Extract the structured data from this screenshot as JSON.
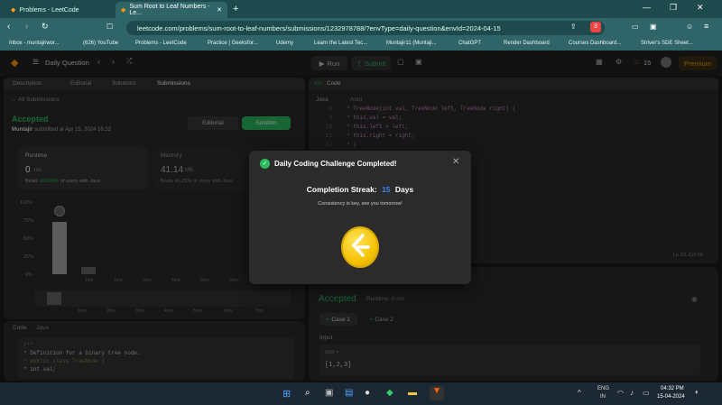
{
  "browser": {
    "tabs": [
      {
        "label": "Problems - LeetCode"
      },
      {
        "label": "Sum Root to Leaf Numbers - Le..."
      }
    ],
    "new_tab": "+",
    "url": "leetcode.com/problems/sum-root-to-leaf-numbers/submissions/1232978788/?envType=daily-question&envId=2024-04-15",
    "bookmarks": [
      "Inbox - muntajirwor...",
      "(626) YouTube",
      "Problems - LeetCode",
      "Practice | Geeksfor...",
      "Udemy",
      "Learn the Latest Tec...",
      "Muntajir11 (Muntaji...",
      "ChatGPT",
      "Render Dashboard",
      "Courses Dashboard...",
      "Striver's SDE Sheet..."
    ],
    "shield_count": "3"
  },
  "lc": {
    "daily_question": "Daily Question",
    "run": "Run",
    "submit": "Submit",
    "streak": "15",
    "premium": "Premium",
    "left_tabs": [
      "Description",
      "Editorial",
      "Solutions",
      "Submissions"
    ],
    "all_submissions": "All Submissions",
    "status": "Accepted",
    "user": "Muntajir",
    "submitted_text": "submitted at Apr 15, 2024 16:32",
    "editorial_btn": "Editorial",
    "solution_btn": "Solution",
    "runtime_label": "Runtime",
    "runtime_value": "0",
    "runtime_unit": "ms",
    "beats_prefix": "Beats",
    "beats_runtime": "100.00%",
    "beats_suffix": "of users with Java",
    "memory_label": "Memory",
    "memory_value": "41.14",
    "memory_unit": "MB",
    "beats_memory": "Beats 41.25% of users with Java",
    "hist_y": [
      "100%",
      "75%",
      "50%",
      "25%",
      "0%"
    ],
    "hist_x_top": [
      "1ms",
      "2ms",
      "3ms",
      "4ms",
      "5ms",
      "6ms"
    ],
    "hist_x_bottom": [
      "1ms",
      "2ms",
      "3ms",
      "4ms",
      "5ms",
      "6ms",
      "7ms"
    ],
    "code_header": "Code",
    "code_lang": "Java",
    "left_code": [
      "/**",
      " * Definition for a binary tree node.",
      " * public class TreeNode {",
      " *     int val;"
    ],
    "right_code_title": "Code",
    "right_lang": "Java",
    "right_auto": "Auto",
    "right_lines": [
      "8",
      "9",
      "10",
      "11",
      "12",
      "13"
    ],
    "right_code": [
      " *     TreeNode(int val, TreeNode left, TreeNode right) {",
      " *         this.val = val;",
      " *         this.left = left;",
      " *         this.right = right;",
      " *     }",
      " * }"
    ],
    "cursor": "Ln 33, Col 59",
    "result": "Accepted",
    "result_runtime": "Runtime: 0 ms",
    "case1": "Case 1",
    "case2": "Case 2",
    "input_label": "Input",
    "root_label": "root =",
    "root_value": "[1,2,3]"
  },
  "modal": {
    "title": "Daily Coding Challenge Completed!",
    "streak_label": "Completion Streak:",
    "streak_num": "15",
    "streak_unit": "Days",
    "subtitle": "Consistency is key, see you tomorrow!"
  },
  "taskbar": {
    "lang1": "ENG",
    "lang2": "IN",
    "time": "04:32 PM",
    "date": "15-04-2024"
  }
}
